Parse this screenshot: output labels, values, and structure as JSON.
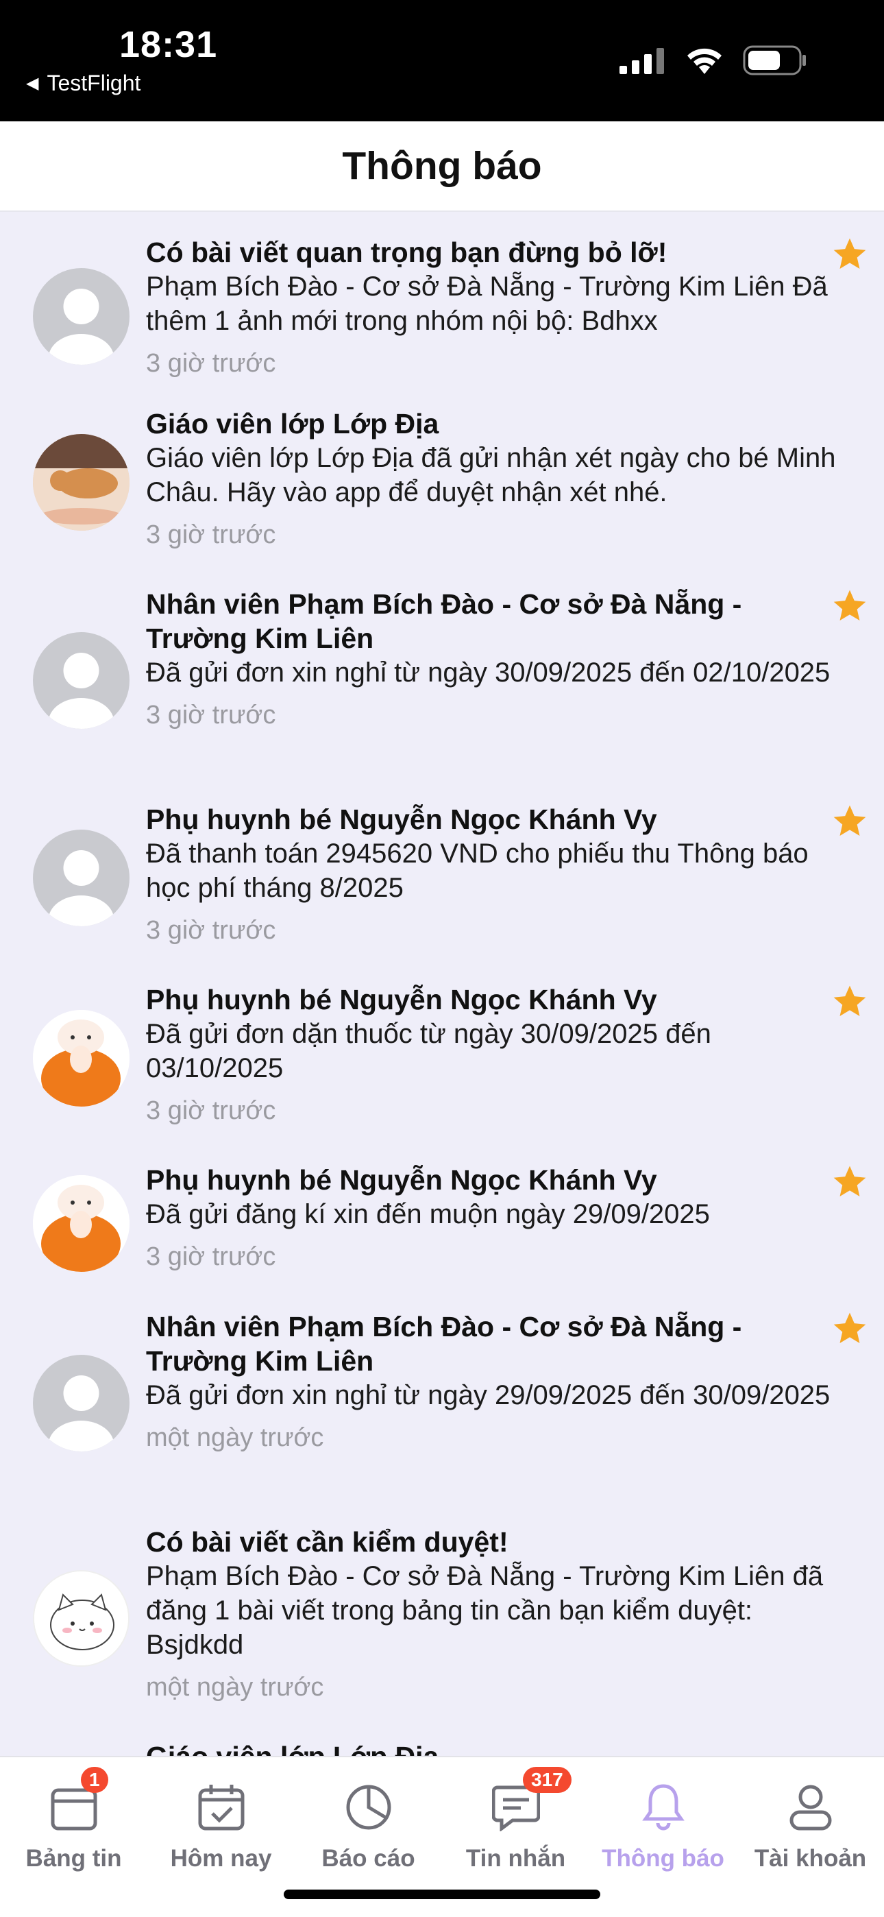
{
  "status_bar": {
    "time": "18:31",
    "back_app": "TestFlight"
  },
  "header": {
    "title": "Thông báo"
  },
  "notifications": [
    {
      "title": "Có bài viết quan trọng bạn đừng bỏ lỡ!",
      "body": "Phạm Bích Đào - Cơ sở Đà Nẵng - Trường Kim Liên Đã thêm 1 ảnh mới trong nhóm nội bộ: Bdhxx",
      "time": "3 giờ trước",
      "starred": true,
      "avatar": "default-avatar-icon"
    },
    {
      "title": "Giáo viên lớp Lớp Địa",
      "body": "Giáo viên lớp Lớp Địa đã gửi nhận xét ngày cho bé Minh Châu. Hãy vào app để duyệt nhận xét nhé.",
      "time": "3 giờ trước",
      "starred": false,
      "avatar": "cat-photo-avatar"
    },
    {
      "title": "Nhân viên Phạm Bích Đào - Cơ sở Đà Nẵng - Trường Kim Liên",
      "body": "Đã gửi đơn xin nghỉ từ ngày 30/09/2025 đến 02/10/2025",
      "time": "3 giờ trước",
      "starred": true,
      "avatar": "default-avatar-icon"
    },
    {
      "title": "Phụ huynh bé Nguyễn Ngọc Khánh Vy",
      "body": "Đã thanh toán 2945620 VND cho phiếu thu Thông báo học phí tháng 8/2025",
      "time": "3 giờ trước",
      "starred": true,
      "avatar": "default-avatar-icon"
    },
    {
      "title": "Phụ huynh bé Nguyễn Ngọc Khánh Vy",
      "body": "Đã gửi đơn dặn thuốc từ ngày 30/09/2025 đến 03/10/2025",
      "time": "3 giờ trước",
      "starred": true,
      "avatar": "cartoon-cat-orange-avatar"
    },
    {
      "title": "Phụ huynh bé Nguyễn Ngọc Khánh Vy",
      "body": "Đã gửi đăng kí xin đến muộn ngày 29/09/2025",
      "time": "3 giờ trước",
      "starred": true,
      "avatar": "cartoon-cat-orange-avatar"
    },
    {
      "title": "Nhân viên Phạm Bích Đào - Cơ sở Đà Nẵng - Trường Kim Liên",
      "body": "Đã gửi đơn xin nghỉ từ ngày 29/09/2025 đến 30/09/2025",
      "time": "một ngày trước",
      "starred": true,
      "avatar": "default-avatar-icon"
    },
    {
      "title": "Có bài viết cần kiểm duyệt!",
      "body": "Phạm Bích Đào - Cơ sở Đà Nẵng - Trường Kim Liên đã đăng 1 bài viết trong bảng tin cần bạn kiểm duyệt: Bsjdkdd",
      "time": "một ngày trước",
      "starred": false,
      "avatar": "cartoon-cat-white-avatar"
    },
    {
      "title": "Giáo viên lớp Lớp Địa",
      "body": "",
      "time": "",
      "starred": false,
      "avatar": "default-avatar-icon"
    }
  ],
  "tabbar": {
    "tabs": [
      {
        "label": "Bảng tin",
        "icon": "newsfeed-icon",
        "badge": "1"
      },
      {
        "label": "Hôm nay",
        "icon": "calendar-check-icon",
        "badge": ""
      },
      {
        "label": "Báo cáo",
        "icon": "pie-chart-icon",
        "badge": ""
      },
      {
        "label": "Tin nhắn",
        "icon": "message-icon",
        "badge": "317"
      },
      {
        "label": "Thông báo",
        "icon": "bell-icon",
        "badge": "",
        "active": true
      },
      {
        "label": "Tài khoản",
        "icon": "user-icon",
        "badge": ""
      }
    ]
  },
  "colors": {
    "accent": "#B7A1EC",
    "star": "#F6A623",
    "badge": "#F4492F",
    "list_bg": "#EFEEF9"
  }
}
